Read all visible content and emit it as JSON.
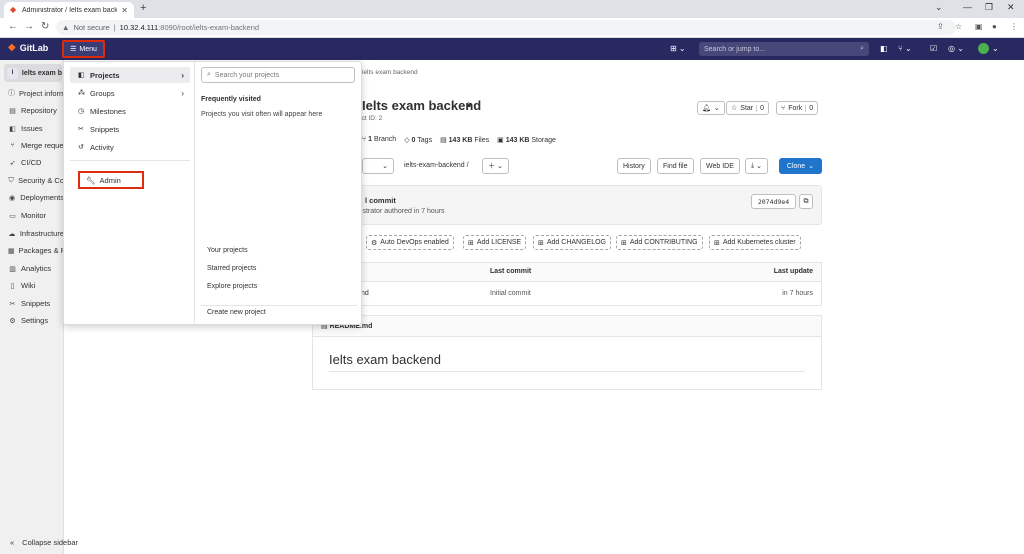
{
  "browser": {
    "tab_title": "Administrator / Ielts exam backe",
    "not_secure": "Not secure",
    "url_host": "10.32.4.111",
    "url_rest": ":8090/root/ielts-exam-backend"
  },
  "header": {
    "brand": "GitLab",
    "menu_label": "Menu",
    "search_placeholder": "Search or jump to..."
  },
  "sidebar": {
    "project_letter": "I",
    "project_name": "Ielts exam b",
    "items": [
      {
        "label": "Project inform",
        "icon": "info-icon"
      },
      {
        "label": "Repository",
        "icon": "repository-icon"
      },
      {
        "label": "Issues",
        "icon": "issues-icon"
      },
      {
        "label": "Merge reque",
        "icon": "merge-request-icon"
      },
      {
        "label": "CI/CD",
        "icon": "rocket-icon"
      },
      {
        "label": "Security & Co",
        "icon": "shield-icon"
      },
      {
        "label": "Deployments",
        "icon": "deployments-icon"
      },
      {
        "label": "Monitor",
        "icon": "monitor-icon"
      },
      {
        "label": "Infrastructure",
        "icon": "cloud-icon"
      },
      {
        "label": "Packages & R",
        "icon": "package-icon"
      },
      {
        "label": "Analytics",
        "icon": "chart-icon"
      },
      {
        "label": "Wiki",
        "icon": "book-icon"
      },
      {
        "label": "Snippets",
        "icon": "scissors-icon"
      },
      {
        "label": "Settings",
        "icon": "gear-icon"
      }
    ],
    "collapse_label": "Collapse sidebar"
  },
  "menu": {
    "items": [
      {
        "label": "Projects",
        "icon": "project-icon"
      },
      {
        "label": "Groups",
        "icon": "group-icon"
      },
      {
        "label": "Milestones",
        "icon": "clock-icon"
      },
      {
        "label": "Snippets",
        "icon": "scissors-icon"
      },
      {
        "label": "Activity",
        "icon": "history-icon"
      }
    ],
    "admin_label": "Admin",
    "search_placeholder": "Search your projects",
    "frequently_visited": "Frequently visited",
    "frequently_desc": "Projects you visit often will appear here",
    "links": [
      "Your projects",
      "Starred projects",
      "Explore projects"
    ],
    "create_label": "Create new project"
  },
  "project": {
    "breadcrumb": "ielts exam backend",
    "title": "Ielts exam backend",
    "id_text": "ect ID: 2",
    "star_label": "Star",
    "star_count": "0",
    "fork_label": "Fork",
    "fork_count": "0",
    "branches": "1",
    "branches_label": "Branch",
    "tags": "0",
    "tags_label": "Tags",
    "files_size": "143 KB",
    "files_label": "Files",
    "storage_size": "143 KB",
    "storage_label": "Storage",
    "path": "ielts-exam-backend",
    "path_sep": "/",
    "history": "History",
    "find_file": "Find file",
    "web_ide": "Web IDE",
    "clone": "Clone",
    "commit_title": "l commit",
    "commit_sub": "nistrator authored in 7 hours",
    "sha": "2074d9e4",
    "devops": "Auto DevOps enabled",
    "add_license": "Add LICENSE",
    "add_changelog": "Add CHANGELOG",
    "add_contributing": "Add CONTRIBUTING",
    "add_k8s": "Add Kubernetes cluster",
    "col_last_commit": "Last commit",
    "col_last_update": "Last update",
    "row_name": "nd",
    "row_commit": "Initial commit",
    "row_update": "in 7 hours",
    "readme_file": "README.md",
    "readme_heading": "Ielts exam backend"
  }
}
